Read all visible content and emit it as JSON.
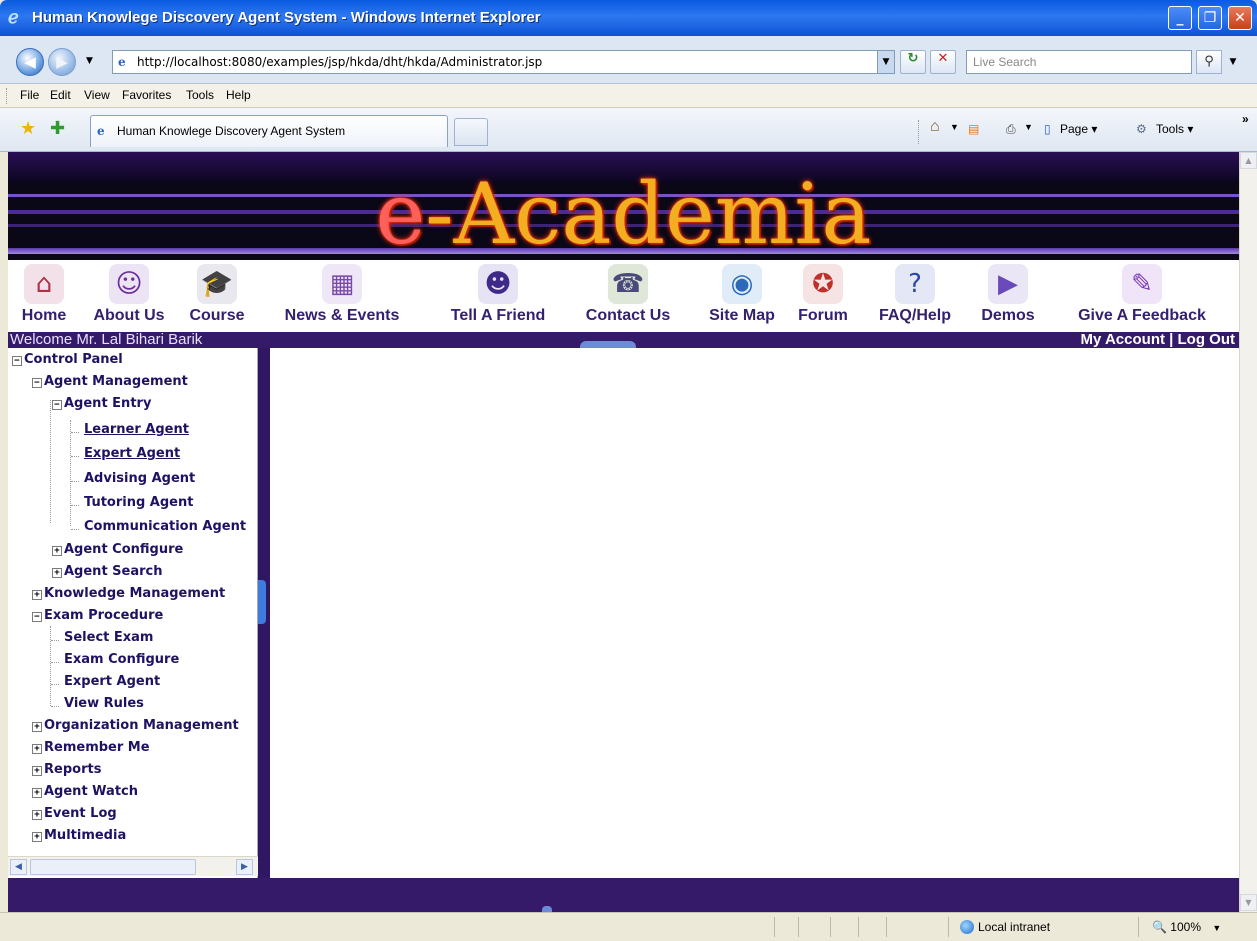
{
  "window": {
    "title": "Human Knowlege Discovery Agent System - Windows Internet Explorer",
    "minimize_glyph": "_",
    "maximize_glyph": "❐",
    "close_glyph": "✕"
  },
  "address_bar": {
    "url": "http://localhost:8080/examples/jsp/hkda/dht/hkda/Administrator.jsp",
    "search_placeholder": "Live Search"
  },
  "menu": {
    "items": [
      "File",
      "Edit",
      "View",
      "Favorites",
      "Tools",
      "Help"
    ]
  },
  "tabs": {
    "active_title": "Human Knowlege Discovery Agent System",
    "commands": {
      "page": "Page ▾",
      "tools": "Tools ▾"
    }
  },
  "page": {
    "banner_title_e": "e",
    "banner_title_rest": "-Academia",
    "nav": [
      {
        "label": "Home",
        "icon": "house-icon"
      },
      {
        "label": "About Us",
        "icon": "people-icon"
      },
      {
        "label": "Course",
        "icon": "graduation-cap-icon"
      },
      {
        "label": "News & Events",
        "icon": "newspaper-reader-icon"
      },
      {
        "label": "Tell A Friend",
        "icon": "friends-icon"
      },
      {
        "label": "Contact Us",
        "icon": "phone-icon"
      },
      {
        "label": "Site Map",
        "icon": "magnifier-globe-icon"
      },
      {
        "label": "Forum",
        "icon": "forum-people-icon"
      },
      {
        "label": "FAQ/Help",
        "icon": "faq-help-icon"
      },
      {
        "label": "Demos",
        "icon": "demos-icon"
      },
      {
        "label": "Give A Feedback",
        "icon": "feedback-pen-icon"
      }
    ],
    "welcome": "Welcome Mr. Lal Bihari Barik",
    "account_links": "My Account | Log Out"
  },
  "tree": {
    "control_panel": "Control Panel",
    "agent_management": "Agent Management",
    "agent_entry": "Agent Entry",
    "learner_agent": "Learner Agent",
    "expert_agent": "Expert Agent",
    "advising_agent": "Advising Agent",
    "tutoring_agent": "Tutoring Agent",
    "communication_agent": "Communication Agent",
    "agent_configure": "Agent Configure",
    "agent_search": "Agent Search",
    "knowledge_management": "Knowledge Management",
    "exam_procedure": "Exam Procedure",
    "select_exam": "Select Exam",
    "exam_configure": "Exam Configure",
    "exam_expert_agent": "Expert Agent",
    "view_rules": "View Rules",
    "organization_management": "Organization Management",
    "remember_me": "Remember Me",
    "reports": "Reports",
    "agent_watch": "Agent Watch",
    "event_log": "Event Log",
    "multimedia": "Multimedia"
  },
  "status_bar": {
    "zone": "Local intranet",
    "zoom": "100%"
  },
  "colors": {
    "nav_label": "#35206f",
    "dark_bar": "#341a68",
    "banner_gold": "#f3ad21",
    "title_bar_blue": "#0a5ae0"
  }
}
